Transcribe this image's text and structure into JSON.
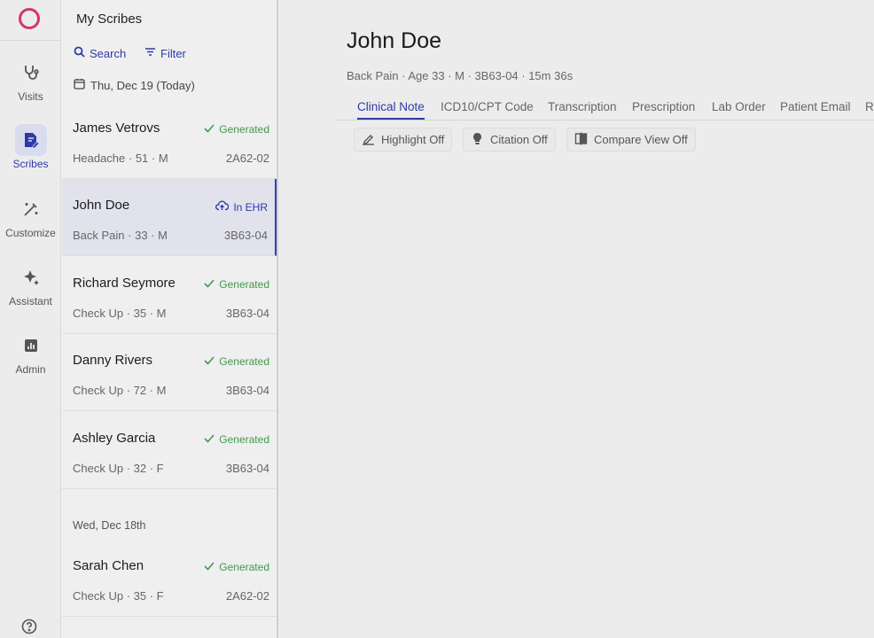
{
  "nav": {
    "items": [
      {
        "label": "Visits",
        "icon": "stethoscope-icon"
      },
      {
        "label": "Scribes",
        "icon": "note-pen-icon"
      },
      {
        "label": "Customize",
        "icon": "magic-wand-icon"
      },
      {
        "label": "Assistant",
        "icon": "sparkle-icon"
      },
      {
        "label": "Admin",
        "icon": "chart-icon"
      }
    ],
    "active": "Scribes",
    "help_icon": "help-circle-icon",
    "brand_color": "#d6336c",
    "accent_color": "#2e3aa8"
  },
  "panel": {
    "title": "My Scribes",
    "search_label": "Search",
    "filter_label": "Filter",
    "today_label": "Thu, Dec 19 (Today)",
    "yesterday_label": "Wed, Dec 18th",
    "cards": [
      {
        "name": "James Vetrovs",
        "status": "Generated",
        "meta": "Headache · 51 · M",
        "code": "2A62-02"
      },
      {
        "name": "John Doe",
        "status": "In EHR",
        "meta": "Back Pain · 33 · M",
        "code": "3B63-04"
      },
      {
        "name": "Richard Seymore",
        "status": "Generated",
        "meta": "Check Up · 35 · M",
        "code": "3B63-04"
      },
      {
        "name": "Danny Rivers",
        "status": "Generated",
        "meta": "Check Up · 72 · M",
        "code": "3B63-04"
      },
      {
        "name": "Ashley Garcia",
        "status": "Generated",
        "meta": "Check Up · 32 · F",
        "code": "3B63-04"
      },
      {
        "name": "Sarah Chen",
        "status": "Generated",
        "meta": "Check Up · 35 · F",
        "code": "2A62-02"
      }
    ]
  },
  "main": {
    "patient_name": "John Doe",
    "patient_meta": "Back Pain · Age 33 · M · 3B63-04 · 15m 36s",
    "tabs": [
      "Clinical Note",
      "ICD10/CPT Code",
      "Transcription",
      "Prescription",
      "Lab Order",
      "Patient Email",
      "Re"
    ],
    "active_tab": "Clinical Note",
    "toggles": [
      {
        "label": "Highlight Off",
        "icon": "highlighter-icon"
      },
      {
        "label": "Citation Off",
        "icon": "lightbulb-icon"
      },
      {
        "label": "Compare View Off",
        "icon": "compare-icon"
      }
    ]
  }
}
